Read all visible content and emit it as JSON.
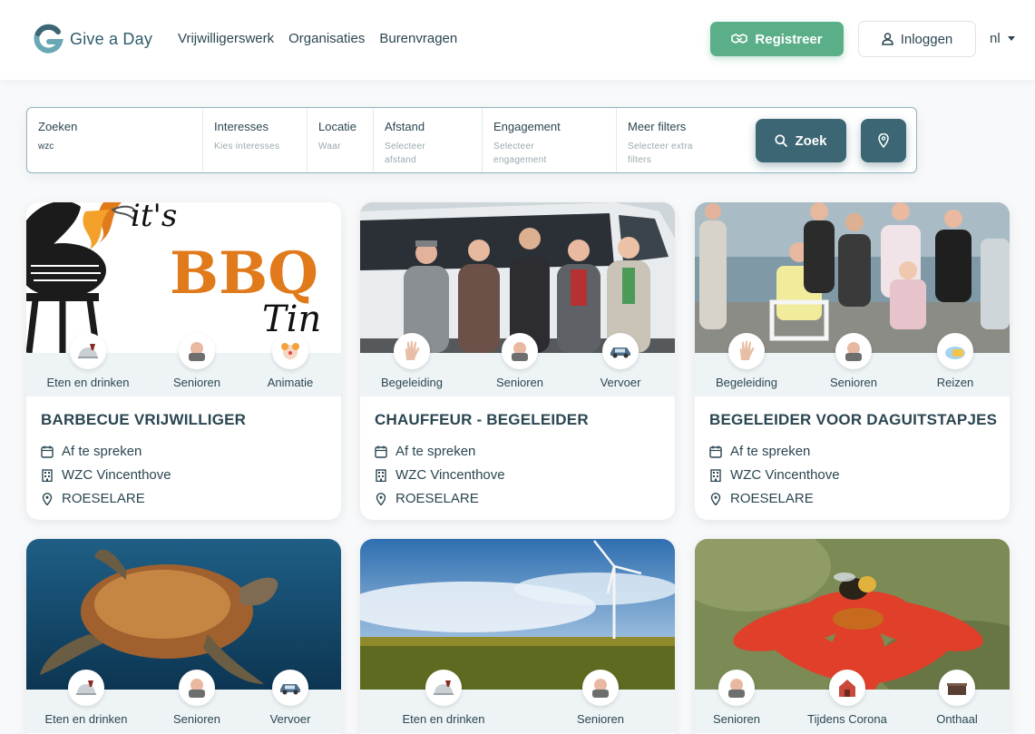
{
  "header": {
    "brand": "Give a Day",
    "nav": [
      "Vrijwilligerswerk",
      "Organisaties",
      "Burenvragen"
    ],
    "register_label": "Registreer",
    "login_label": "Inloggen",
    "language": "nl"
  },
  "search": {
    "fields": [
      {
        "label": "Zoeken",
        "value": "wzc"
      },
      {
        "label": "Interesses",
        "placeholder": "Kies interesses"
      },
      {
        "label": "Locatie",
        "placeholder": "Waar"
      },
      {
        "label": "Afstand",
        "placeholder": "Selecteer afstand"
      },
      {
        "label": "Engagement",
        "placeholder": "Selecteer engagement"
      },
      {
        "label": "Meer filters",
        "placeholder": "Selecteer extra filters"
      }
    ],
    "button_label": "Zoek",
    "map_icon": "location-pin-icon"
  },
  "cards": [
    {
      "image": "bbq-image",
      "image_text": [
        "it's",
        "BBQ",
        "Tin"
      ],
      "categories": [
        "Eten en drinken",
        "Senioren",
        "Animatie"
      ],
      "title": "BARBECUE VRIJWILLIGER",
      "engagement": "Af te spreken",
      "organisation": "WZC Vincenthove",
      "location": "ROESELARE"
    },
    {
      "image": "group-photo-bus",
      "categories": [
        "Begeleiding",
        "Senioren",
        "Vervoer"
      ],
      "title": "CHAUFFEUR - BEGELEIDER",
      "engagement": "Af te spreken",
      "organisation": "WZC Vincenthove",
      "location": "ROESELARE"
    },
    {
      "image": "beach-group-photo",
      "categories": [
        "Begeleiding",
        "Senioren",
        "Reizen"
      ],
      "title": "BEGELEIDER VOOR DAGUITSTAPJES",
      "engagement": "Af te spreken",
      "organisation": "WZC Vincenthove",
      "location": "ROESELARE"
    },
    {
      "image": "sea-turtle-photo",
      "categories": [
        "Eten en drinken",
        "Senioren",
        "Vervoer"
      ]
    },
    {
      "image": "wind-turbine-sunflower-field",
      "categories": [
        "Eten en drinken",
        "Senioren"
      ]
    },
    {
      "image": "bee-on-red-flower",
      "categories": [
        "Senioren",
        "Tijdens Corona",
        "Onthaal"
      ]
    }
  ],
  "colors": {
    "primary": "#3d6674",
    "accent": "#5aae88",
    "text": "#2b4651",
    "band": "#eef4f6"
  }
}
